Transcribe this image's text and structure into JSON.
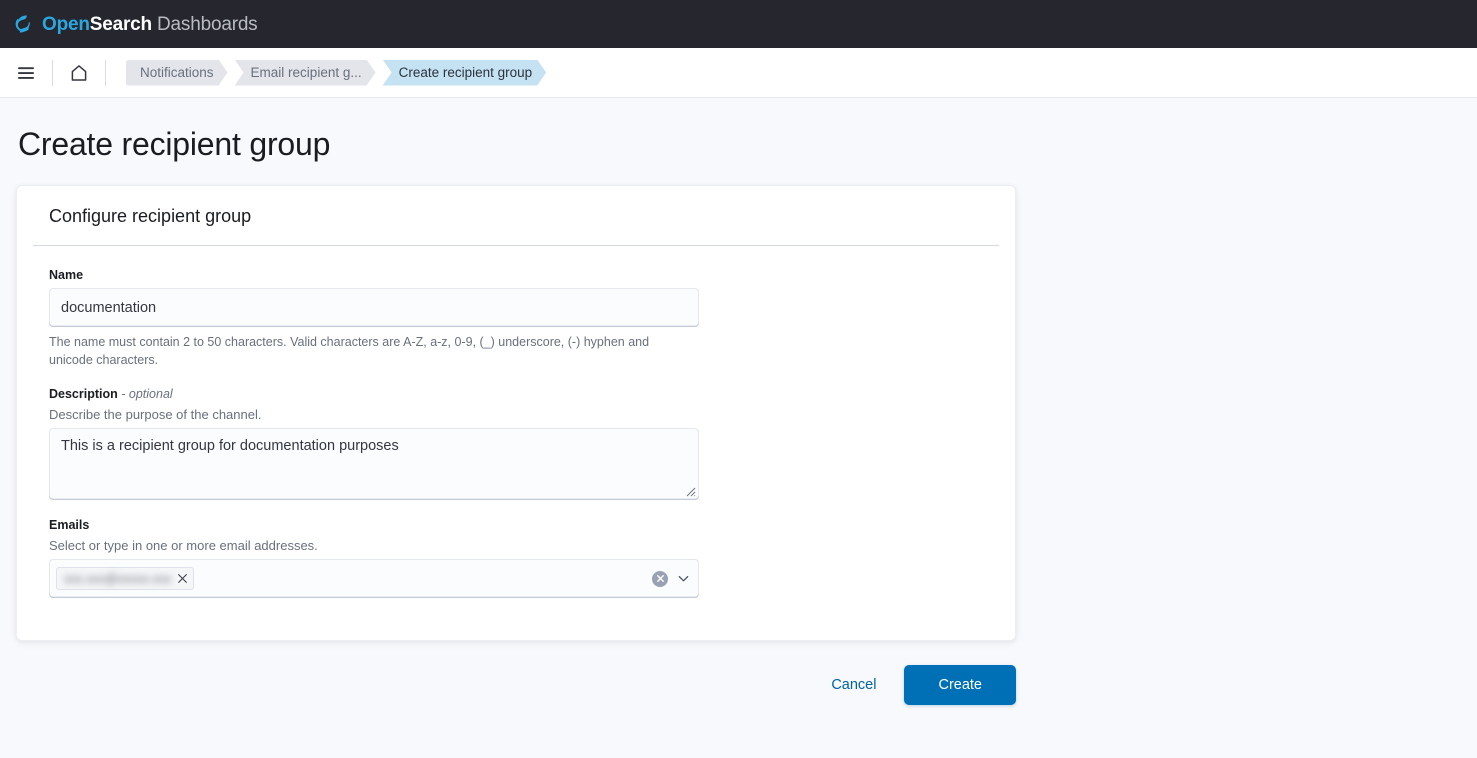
{
  "header": {
    "logo_icon": "opensearch-logo-icon",
    "brand_open": "Open",
    "brand_search": "Search",
    "brand_dashboards": " Dashboards"
  },
  "nav": {
    "menu_icon": "hamburger-menu-icon",
    "home_icon": "home-icon",
    "breadcrumbs": [
      {
        "label": "Notifications",
        "active": false
      },
      {
        "label": "Email recipient g...",
        "active": false
      },
      {
        "label": "Create recipient group",
        "active": true
      }
    ]
  },
  "page": {
    "title": "Create recipient group"
  },
  "panel": {
    "title": "Configure recipient group",
    "name_field": {
      "label": "Name",
      "value": "documentation",
      "placeholder": "",
      "help": "The name must contain 2 to 50 characters. Valid characters are A-Z, a-z, 0-9, (_) underscore, (-) hyphen and unicode characters."
    },
    "description_field": {
      "label": "Description",
      "optional_tag": "- optional",
      "sublabel": "Describe the purpose of the channel.",
      "value": "This is a recipient group for documentation purposes",
      "placeholder": "",
      "resize_icon": "resize-grip-icon"
    },
    "emails_field": {
      "label": "Emails",
      "sublabel": "Select or type in one or more email addresses.",
      "pills": [
        {
          "text": "xxx.xxx@xxxxx.xxx",
          "remove_icon": "close-icon"
        }
      ],
      "clear_icon": "clear-circle-icon",
      "chevron_icon": "chevron-down-icon",
      "placeholder": ""
    }
  },
  "footer": {
    "cancel_label": "Cancel",
    "create_label": "Create"
  },
  "colors": {
    "header_bg": "#25262e",
    "accent_blue": "#0070b6",
    "link_blue": "#0061a4",
    "active_crumb": "#c4e2f2",
    "page_bg": "#f8f9fc"
  }
}
